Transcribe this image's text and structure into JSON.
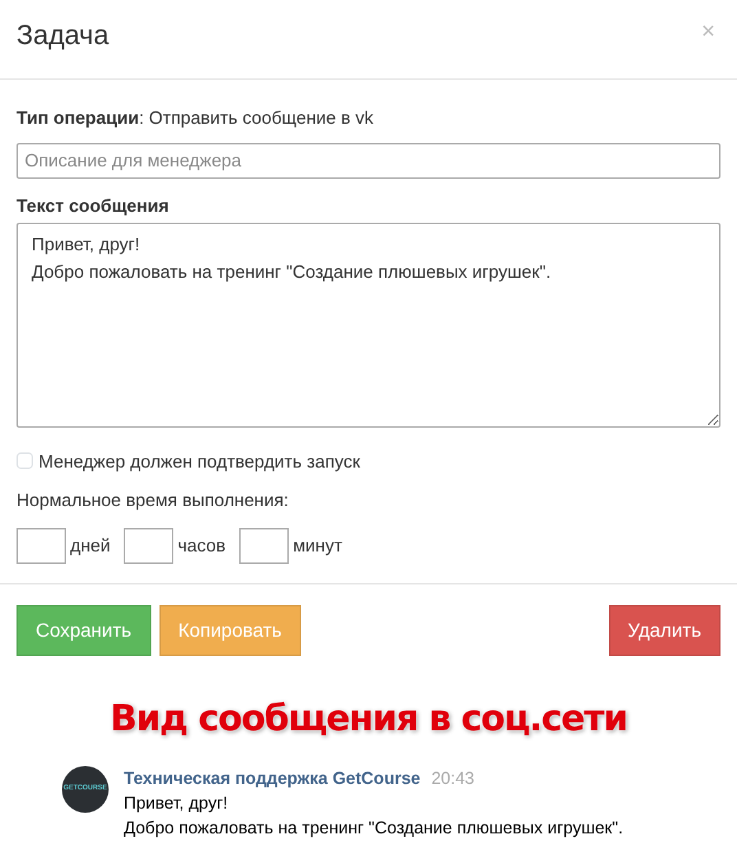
{
  "modal": {
    "title": "Задача",
    "close": "×"
  },
  "operation": {
    "text": "**Тип операции**: Отправить сообщение в vk"
  },
  "description": {
    "placeholder": "Описание для менеджера"
  },
  "message_field": {
    "label": "Текст сообщения",
    "value": "Привет, друг!\nДобро пожаловать на тренинг \"Создание плюшевых игрушек\"."
  },
  "confirm": {
    "label": "Менеджер должен подтвердить запуск",
    "checked": false
  },
  "duration": {
    "label": "Нормальное время выполнения:",
    "units": [
      "дней",
      "часов",
      "минут"
    ]
  },
  "buttons": [
    {
      "label": "Сохранить",
      "kind": "success"
    },
    {
      "label": "Копировать",
      "kind": "warning"
    },
    {
      "label": "Удалить",
      "kind": "danger"
    }
  ],
  "annotation": "Вид сообщения в соц.сети",
  "preview": {
    "avatar_text": "GETCOURSE",
    "author": "Техническая поддержка GetCourse",
    "time": "20:43",
    "lines": [
      "Привет, друг!",
      "Добро пожаловать на тренинг \"Создание плюшевых игрушек\"."
    ]
  }
}
